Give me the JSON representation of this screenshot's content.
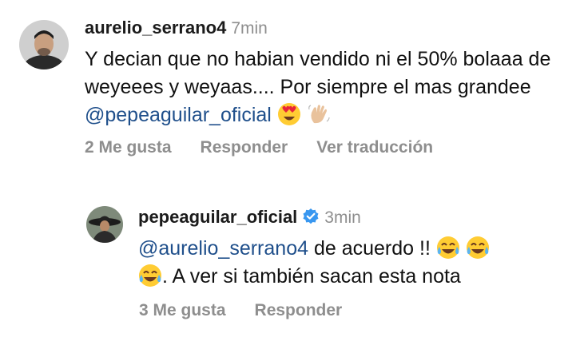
{
  "comment": {
    "username": "aurelio_serrano4",
    "time": "7min",
    "text_part1": "Y decian que no habian vendido ni el 50% bolaaa de weyeees y weyaas.... Por siempre el mas grandee ",
    "mention": "@pepeaguilar_oficial",
    "emojis": [
      "heart-eyes-emoji",
      "waving-hand-emoji"
    ],
    "likes": "2 Me gusta",
    "reply_label": "Responder",
    "translate_label": "Ver traducción"
  },
  "reply": {
    "username": "pepeaguilar_oficial",
    "verified": true,
    "time": "3min",
    "mention": "@aurelio_serrano4",
    "text_part1": " de acuerdo !! ",
    "text_part2": ". A ver si también sacan esta nota",
    "emojis": [
      "tears-of-joy-emoji",
      "tears-of-joy-emoji",
      "tears-of-joy-emoji"
    ],
    "likes": "3 Me gusta",
    "reply_label": "Responder"
  },
  "colors": {
    "mention": "#1f4f8b",
    "muted": "#8e8e8e",
    "verified": "#3897f0"
  }
}
